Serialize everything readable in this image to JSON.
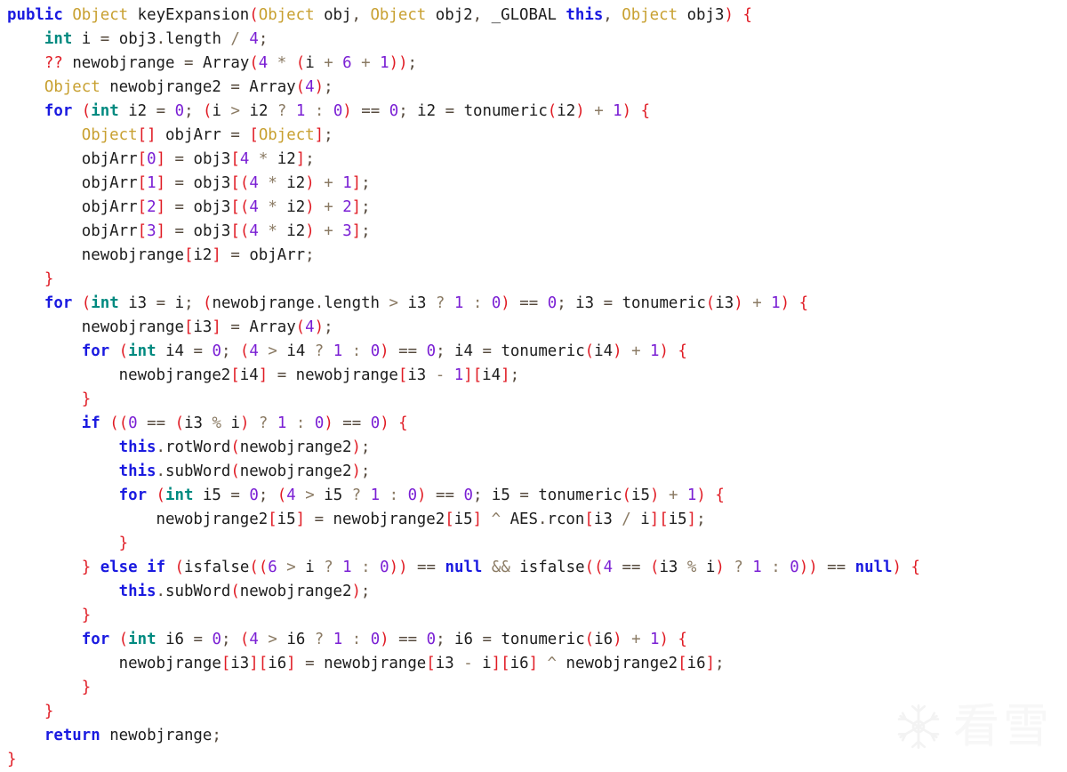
{
  "editor": {
    "language": "java-like-decompiled",
    "background_color": "#ffffff",
    "font_size_px": 17.4,
    "line_height_px": 27,
    "tab_width": 4,
    "colors": {
      "plain": "#1c1c1c",
      "keyword": "#1a1ae0",
      "type": "#c8a030",
      "primitive": "#008a80",
      "punctuation": "#e01b24",
      "number": "#7a1fd4",
      "operator": "#8a7a63",
      "assign": "#55493c"
    }
  },
  "watermark": {
    "icon_name": "snowflake-icon",
    "text": "看雪",
    "color": "#f6f6f6"
  },
  "code": {
    "function_name": "keyExpansion",
    "total_lines": 31,
    "lines": [
      {
        "n": 1,
        "indent": 0,
        "text": "public Object keyExpansion(Object obj, Object obj2, _GLOBAL this, Object obj3) {"
      },
      {
        "n": 2,
        "indent": 1,
        "text": "int i = obj3.length / 4;"
      },
      {
        "n": 3,
        "indent": 1,
        "text": "?? newobjrange = Array(4 * (i + 6 + 1));"
      },
      {
        "n": 4,
        "indent": 1,
        "text": "Object newobjrange2 = Array(4);"
      },
      {
        "n": 5,
        "indent": 1,
        "text": "for (int i2 = 0; (i > i2 ? 1 : 0) == 0; i2 = tonumeric(i2) + 1) {"
      },
      {
        "n": 6,
        "indent": 2,
        "text": "Object[] objArr = [Object];"
      },
      {
        "n": 7,
        "indent": 2,
        "text": "objArr[0] = obj3[4 * i2];"
      },
      {
        "n": 8,
        "indent": 2,
        "text": "objArr[1] = obj3[(4 * i2) + 1];"
      },
      {
        "n": 9,
        "indent": 2,
        "text": "objArr[2] = obj3[(4 * i2) + 2];"
      },
      {
        "n": 10,
        "indent": 2,
        "text": "objArr[3] = obj3[(4 * i2) + 3];"
      },
      {
        "n": 11,
        "indent": 2,
        "text": "newobjrange[i2] = objArr;"
      },
      {
        "n": 12,
        "indent": 1,
        "text": "}"
      },
      {
        "n": 13,
        "indent": 1,
        "text": "for (int i3 = i; (newobjrange.length > i3 ? 1 : 0) == 0; i3 = tonumeric(i3) + 1) {"
      },
      {
        "n": 14,
        "indent": 2,
        "text": "newobjrange[i3] = Array(4);"
      },
      {
        "n": 15,
        "indent": 2,
        "text": "for (int i4 = 0; (4 > i4 ? 1 : 0) == 0; i4 = tonumeric(i4) + 1) {"
      },
      {
        "n": 16,
        "indent": 3,
        "text": "newobjrange2[i4] = newobjrange[i3 - 1][i4];"
      },
      {
        "n": 17,
        "indent": 2,
        "text": "}"
      },
      {
        "n": 18,
        "indent": 2,
        "text": "if ((0 == (i3 % i) ? 1 : 0) == 0) {"
      },
      {
        "n": 19,
        "indent": 3,
        "text": "this.rotWord(newobjrange2);"
      },
      {
        "n": 20,
        "indent": 3,
        "text": "this.subWord(newobjrange2);"
      },
      {
        "n": 21,
        "indent": 3,
        "text": "for (int i5 = 0; (4 > i5 ? 1 : 0) == 0; i5 = tonumeric(i5) + 1) {"
      },
      {
        "n": 22,
        "indent": 4,
        "text": "newobjrange2[i5] = newobjrange2[i5] ^ AES.rcon[i3 / i][i5];"
      },
      {
        "n": 23,
        "indent": 3,
        "text": "}"
      },
      {
        "n": 24,
        "indent": 2,
        "text": "} else if (isfalse((6 > i ? 1 : 0)) == null && isfalse((4 == (i3 % i) ? 1 : 0)) == null) {"
      },
      {
        "n": 25,
        "indent": 3,
        "text": "this.subWord(newobjrange2);"
      },
      {
        "n": 26,
        "indent": 2,
        "text": "}"
      },
      {
        "n": 27,
        "indent": 2,
        "text": "for (int i6 = 0; (4 > i6 ? 1 : 0) == 0; i6 = tonumeric(i6) + 1) {"
      },
      {
        "n": 28,
        "indent": 3,
        "text": "newobjrange[i3][i6] = newobjrange[i3 - i][i6] ^ newobjrange2[i6];"
      },
      {
        "n": 29,
        "indent": 2,
        "text": "}"
      },
      {
        "n": 30,
        "indent": 1,
        "text": "}"
      },
      {
        "n": 31,
        "indent": 1,
        "text": "return newobjrange;"
      },
      {
        "n": 32,
        "indent": 0,
        "text": "}"
      }
    ],
    "tokens": {
      "keywords": [
        "public",
        "for",
        "if",
        "else",
        "return",
        "this",
        "null"
      ],
      "primitives": [
        "int"
      ],
      "types": [
        "Object"
      ],
      "punctuation": [
        "(",
        ")",
        "[",
        "]",
        "{",
        "}",
        "??"
      ],
      "operators": [
        ">",
        "?",
        ":",
        "+",
        "-",
        "*",
        "%",
        "^",
        "/",
        "&&"
      ],
      "identifiers": [
        "keyExpansion",
        "obj",
        "obj2",
        "obj3",
        "_GLOBAL",
        "i",
        "i2",
        "i3",
        "i4",
        "i5",
        "i6",
        "newobjrange",
        "newobjrange2",
        "objArr",
        "Array",
        "tonumeric",
        "isfalse",
        "length",
        "rotWord",
        "subWord",
        "AES",
        "rcon"
      ],
      "numbers": [
        "0",
        "1",
        "2",
        "3",
        "4",
        "6"
      ]
    }
  }
}
